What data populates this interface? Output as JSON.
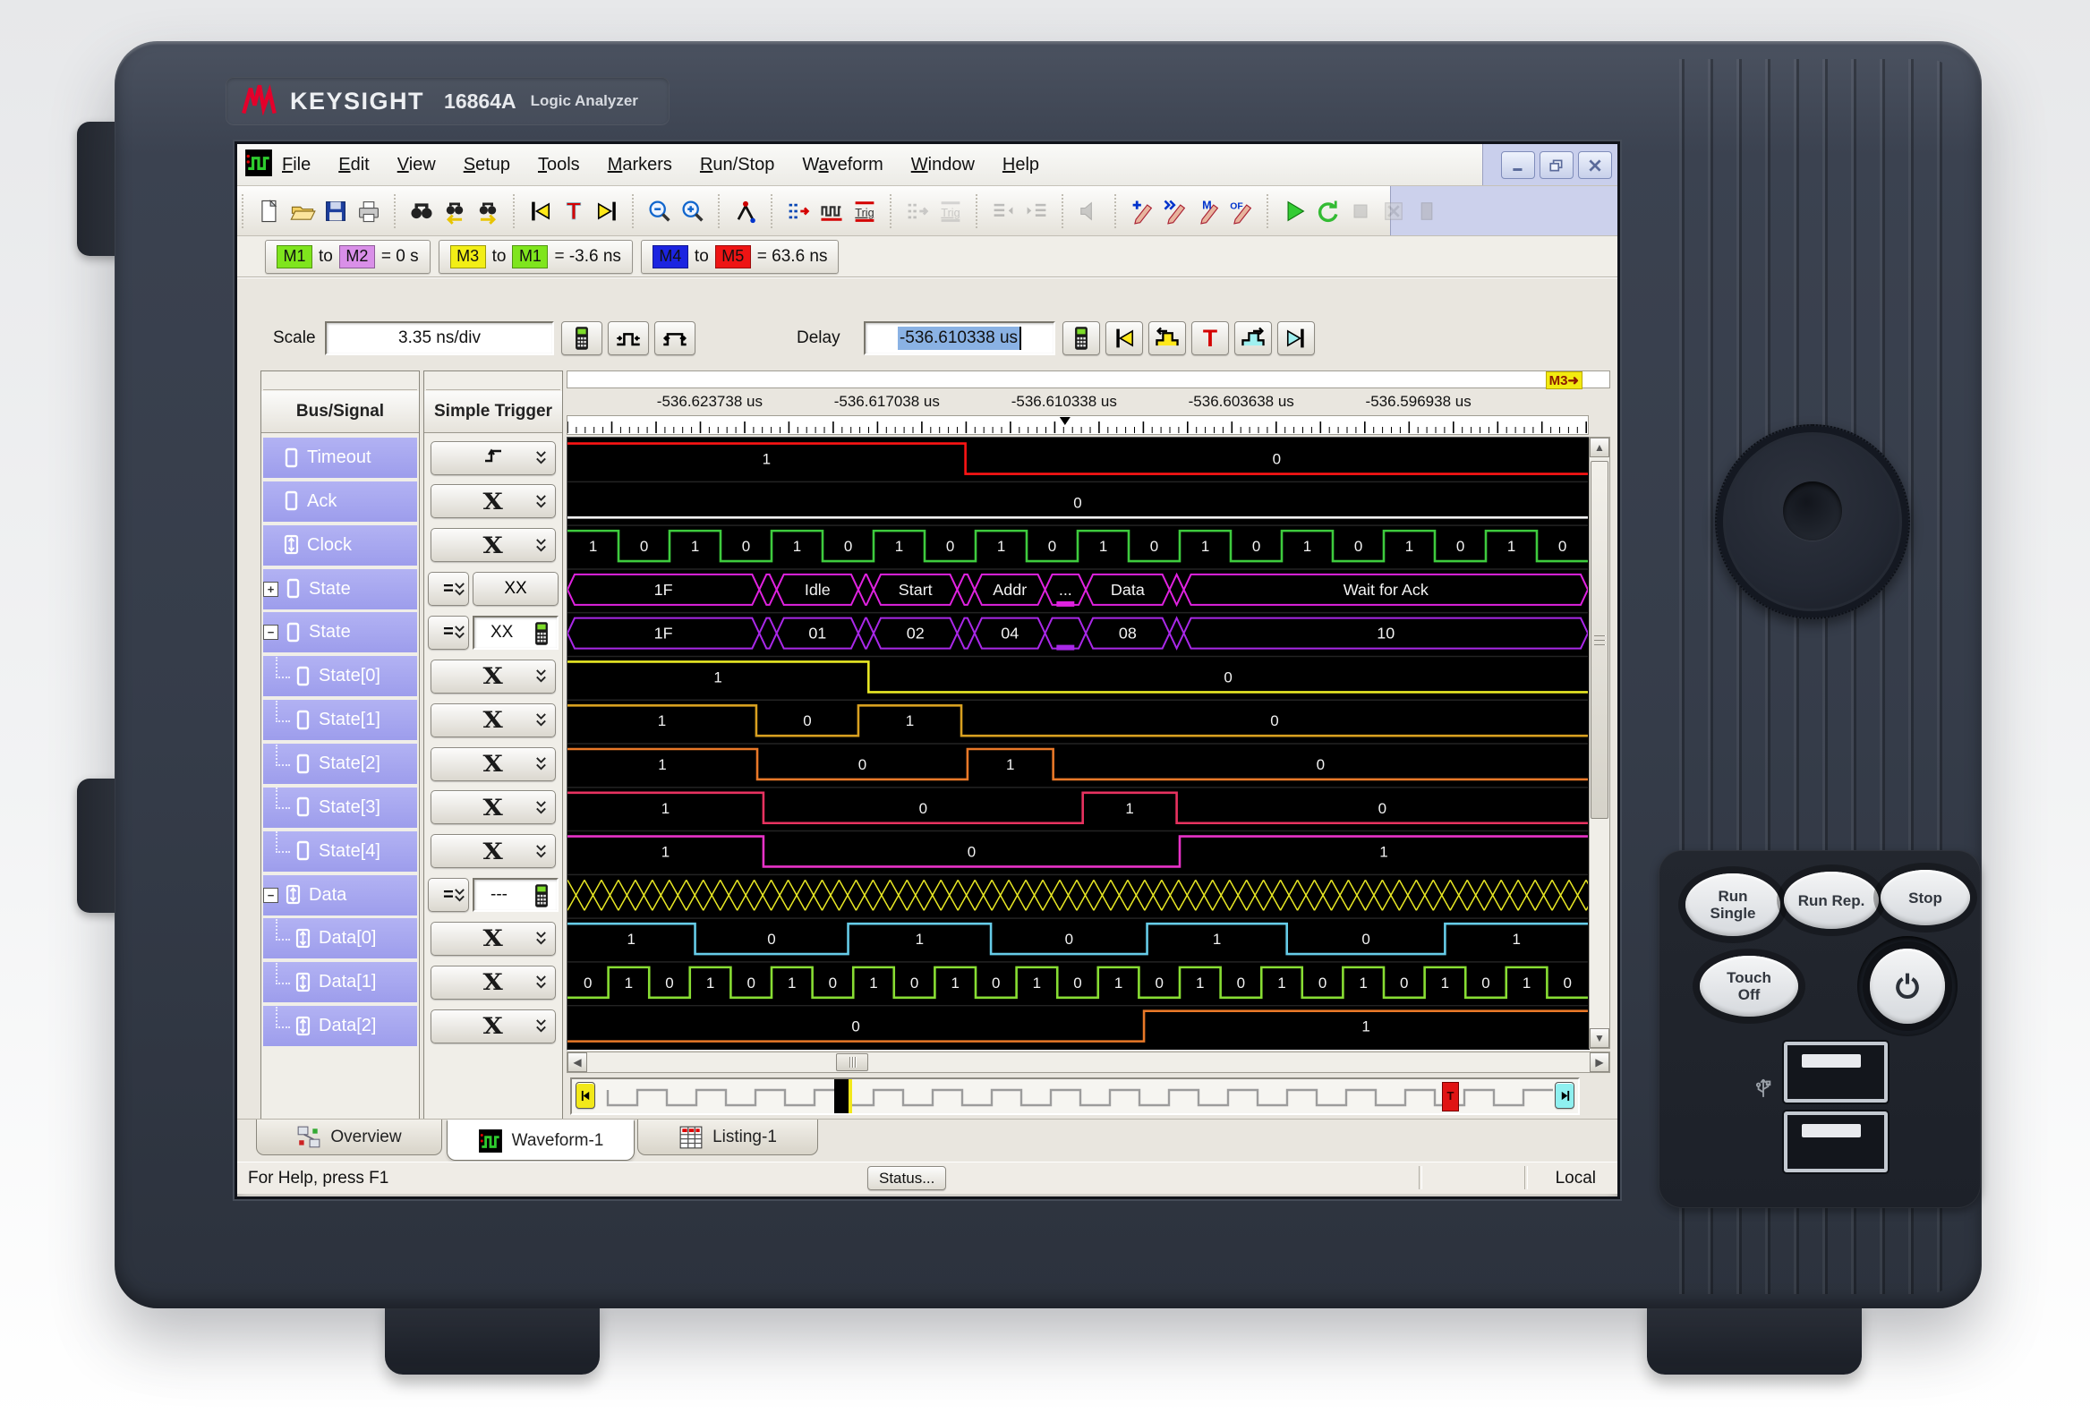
{
  "device": {
    "brand": "KEYSIGHT",
    "model": "16864A",
    "model_desc": "Logic Analyzer",
    "panel_buttons": [
      {
        "name": "run-single",
        "lines": [
          "Run",
          "Single"
        ]
      },
      {
        "name": "run-repetitive",
        "lines": [
          "Run Rep."
        ]
      },
      {
        "name": "stop",
        "lines": [
          "Stop"
        ]
      },
      {
        "name": "touch-off",
        "lines": [
          "Touch",
          "Off"
        ]
      },
      {
        "name": "power",
        "lines": [],
        "icon": "power-icon"
      }
    ],
    "ports": [
      "usb-port-top",
      "usb-port-bottom"
    ]
  },
  "window": {
    "menu": [
      {
        "label": "File",
        "u": 0
      },
      {
        "label": "Edit",
        "u": 0
      },
      {
        "label": "View",
        "u": 0
      },
      {
        "label": "Setup",
        "u": 0
      },
      {
        "label": "Tools",
        "u": 0
      },
      {
        "label": "Markers",
        "u": 0
      },
      {
        "label": "Run/Stop",
        "u": 0
      },
      {
        "label": "Waveform",
        "u": 1
      },
      {
        "label": "Window",
        "u": 0
      },
      {
        "label": "Help",
        "u": 0
      }
    ],
    "app_icon": "waveform-app-icon",
    "window_buttons": [
      "minimize",
      "restore",
      "close"
    ],
    "toolbar_groups": [
      {
        "items": [
          {
            "name": "new-document"
          },
          {
            "name": "open-file"
          },
          {
            "name": "save"
          },
          {
            "name": "print"
          }
        ]
      },
      {
        "items": [
          {
            "name": "find"
          },
          {
            "name": "find-previous"
          },
          {
            "name": "find-next"
          }
        ]
      },
      {
        "items": [
          {
            "name": "go-to-start"
          },
          {
            "name": "go-to-trigger"
          },
          {
            "name": "go-to-end"
          }
        ]
      },
      {
        "items": [
          {
            "name": "zoom-out"
          },
          {
            "name": "zoom-in"
          }
        ]
      },
      {
        "items": [
          {
            "name": "marker-tool"
          }
        ]
      },
      {
        "items": [
          {
            "name": "bus-signal-setup"
          },
          {
            "name": "sampling-setup"
          },
          {
            "name": "trigger-setup"
          }
        ]
      },
      {
        "items": [
          {
            "name": "bus-signal-setup-alt",
            "disabled": true
          },
          {
            "name": "trigger-setup-alt",
            "disabled": true
          }
        ]
      },
      {
        "items": [
          {
            "name": "listing-move-left",
            "disabled": true
          },
          {
            "name": "listing-move-right",
            "disabled": true
          }
        ]
      },
      {
        "items": [
          {
            "name": "sound",
            "disabled": true
          }
        ]
      },
      {
        "items": [
          {
            "name": "marker-new"
          },
          {
            "name": "marker-next"
          },
          {
            "name": "marker-goto"
          },
          {
            "name": "marker-options"
          }
        ]
      },
      {
        "items": [
          {
            "name": "run"
          },
          {
            "name": "run-repetitive"
          },
          {
            "name": "stop-run",
            "disabled": true
          },
          {
            "name": "cancel",
            "disabled": true
          },
          {
            "name": "halt",
            "disabled": true
          }
        ]
      }
    ],
    "markers_bar": [
      {
        "a": "M1",
        "a_color": "#7fe51d",
        "b": "M2",
        "b_color": "#d98fe8",
        "value": "= 0 s"
      },
      {
        "a": "M3",
        "a_color": "#f2ee16",
        "b": "M1",
        "b_color": "#7fe51d",
        "value": "= -3.6 ns"
      },
      {
        "a": "M4",
        "a_color": "#1c24e0",
        "b": "M5",
        "b_color": "#ee1414",
        "value": "= 63.6 ns"
      }
    ],
    "controls": {
      "scale_label": "Scale",
      "scale_value": "3.35 ns/div",
      "scale_buttons": [
        "calculator",
        "pulse-zoom-in",
        "pulse-zoom-out"
      ],
      "delay_label": "Delay",
      "delay_value": "-536.610338 us",
      "delay_buttons": [
        "calculator",
        "delay-go-start",
        "delay-prev-edge",
        "delay-trigger",
        "delay-next-edge",
        "delay-go-end"
      ]
    },
    "columns": {
      "bus_signal_header": "Bus/Signal",
      "simple_trigger_header": "Simple Trigger"
    },
    "signals": [
      {
        "name": "Timeout",
        "icon": "signal",
        "child": false,
        "trigger": {
          "kind": "edge"
        }
      },
      {
        "name": "Ack",
        "icon": "signal",
        "child": false,
        "trigger": {
          "kind": "any",
          "glyph": "X"
        }
      },
      {
        "name": "Clock",
        "icon": "clock",
        "child": false,
        "trigger": {
          "kind": "any",
          "glyph": "X"
        }
      },
      {
        "name": "State",
        "icon": "signal",
        "child": false,
        "expand": "+",
        "trigger": {
          "kind": "compare-button",
          "op": "=",
          "value": "XX"
        }
      },
      {
        "name": "State",
        "icon": "signal",
        "child": false,
        "expand": "−",
        "trigger": {
          "kind": "compare-input",
          "op": "=",
          "value": "XX"
        }
      },
      {
        "name": "State[0]",
        "icon": "signal",
        "child": true,
        "trigger": {
          "kind": "any",
          "glyph": "X"
        }
      },
      {
        "name": "State[1]",
        "icon": "signal",
        "child": true,
        "trigger": {
          "kind": "any",
          "glyph": "X"
        }
      },
      {
        "name": "State[2]",
        "icon": "signal",
        "child": true,
        "trigger": {
          "kind": "any",
          "glyph": "X"
        }
      },
      {
        "name": "State[3]",
        "icon": "signal",
        "child": true,
        "trigger": {
          "kind": "any",
          "glyph": "X"
        }
      },
      {
        "name": "State[4]",
        "icon": "signal",
        "child": true,
        "trigger": {
          "kind": "any",
          "glyph": "X"
        }
      },
      {
        "name": "Data",
        "icon": "clock",
        "child": false,
        "expand": "−",
        "trigger": {
          "kind": "compare-input",
          "op": "=",
          "value": "---"
        }
      },
      {
        "name": "Data[0]",
        "icon": "clock",
        "child": true,
        "trigger": {
          "kind": "any",
          "glyph": "X"
        }
      },
      {
        "name": "Data[1]",
        "icon": "clock",
        "child": true,
        "trigger": {
          "kind": "any",
          "glyph": "X"
        }
      },
      {
        "name": "Data[2]",
        "icon": "clock",
        "child": true,
        "trigger": {
          "kind": "any",
          "glyph": "X"
        }
      }
    ],
    "timebase": {
      "axis_labels": [
        "-536.623738 us",
        "-536.617038 us",
        "-536.610338 us",
        "-536.603638 us",
        "-536.596938 us"
      ],
      "axis_label_fracs": [
        0.14,
        0.3133,
        0.4867,
        0.66,
        0.8333
      ],
      "trigger_frac": 0.4867,
      "marker_badge": "M3"
    },
    "waveforms": [
      {
        "name": "Timeout",
        "type": "digital",
        "color": "#ff1414",
        "segs": [
          [
            0,
            0.39,
            1
          ],
          [
            0.39,
            1,
            0
          ]
        ]
      },
      {
        "name": "Ack",
        "type": "digital",
        "color": "#f2f2f2",
        "segs": [
          [
            0,
            1,
            0
          ]
        ]
      },
      {
        "name": "Clock",
        "type": "digital",
        "color": "#3ecb3e",
        "segs": [
          [
            0,
            0.05,
            1
          ],
          [
            0.05,
            0.1,
            0
          ],
          [
            0.1,
            0.15,
            1
          ],
          [
            0.15,
            0.2,
            0
          ],
          [
            0.2,
            0.25,
            1
          ],
          [
            0.25,
            0.3,
            0
          ],
          [
            0.3,
            0.35,
            1
          ],
          [
            0.35,
            0.4,
            0
          ],
          [
            0.4,
            0.45,
            1
          ],
          [
            0.45,
            0.5,
            0
          ],
          [
            0.5,
            0.55,
            1
          ],
          [
            0.55,
            0.6,
            0
          ],
          [
            0.6,
            0.65,
            1
          ],
          [
            0.65,
            0.7,
            0
          ],
          [
            0.7,
            0.75,
            1
          ],
          [
            0.75,
            0.8,
            0
          ],
          [
            0.8,
            0.85,
            1
          ],
          [
            0.85,
            0.9,
            0
          ],
          [
            0.9,
            0.95,
            1
          ],
          [
            0.95,
            1,
            0
          ]
        ]
      },
      {
        "name": "State",
        "type": "bus",
        "color": "#e022e0",
        "segs": [
          {
            "a": 0,
            "b": 0.188,
            "t": "1F"
          },
          {
            "a": 0.188,
            "b": 0.205,
            "t": ""
          },
          {
            "a": 0.205,
            "b": 0.285,
            "t": "Idle"
          },
          {
            "a": 0.285,
            "b": 0.3,
            "t": ""
          },
          {
            "a": 0.3,
            "b": 0.382,
            "t": "Start"
          },
          {
            "a": 0.382,
            "b": 0.399,
            "t": ""
          },
          {
            "a": 0.399,
            "b": 0.468,
            "t": "Addr"
          },
          {
            "a": 0.468,
            "b": 0.508,
            "t": "...",
            "c": 1
          },
          {
            "a": 0.508,
            "b": 0.59,
            "t": "Data"
          },
          {
            "a": 0.59,
            "b": 0.604,
            "t": ""
          },
          {
            "a": 0.604,
            "b": 1,
            "t": "Wait for Ack"
          }
        ]
      },
      {
        "name": "State",
        "type": "bus",
        "color": "#a928e8",
        "segs": [
          {
            "a": 0,
            "b": 0.188,
            "t": "1F"
          },
          {
            "a": 0.188,
            "b": 0.205,
            "t": ""
          },
          {
            "a": 0.205,
            "b": 0.285,
            "t": "01"
          },
          {
            "a": 0.285,
            "b": 0.3,
            "t": ""
          },
          {
            "a": 0.3,
            "b": 0.382,
            "t": "02"
          },
          {
            "a": 0.382,
            "b": 0.399,
            "t": ""
          },
          {
            "a": 0.399,
            "b": 0.468,
            "t": "04"
          },
          {
            "a": 0.468,
            "b": 0.508,
            "t": "",
            "c": 1
          },
          {
            "a": 0.508,
            "b": 0.59,
            "t": "08"
          },
          {
            "a": 0.59,
            "b": 0.604,
            "t": ""
          },
          {
            "a": 0.604,
            "b": 1,
            "t": "10"
          }
        ]
      },
      {
        "name": "State[0]",
        "type": "digital",
        "color": "#e8e824",
        "segs": [
          [
            0,
            0.295,
            1
          ],
          [
            0.295,
            1,
            0
          ]
        ]
      },
      {
        "name": "State[1]",
        "type": "digital",
        "color": "#d8a020",
        "segs": [
          [
            0,
            0.185,
            1
          ],
          [
            0.185,
            0.285,
            0
          ],
          [
            0.285,
            0.386,
            1
          ],
          [
            0.386,
            1,
            0
          ]
        ]
      },
      {
        "name": "State[2]",
        "type": "digital",
        "color": "#e87828",
        "segs": [
          [
            0,
            0.186,
            1
          ],
          [
            0.186,
            0.392,
            0
          ],
          [
            0.392,
            0.476,
            1
          ],
          [
            0.476,
            1,
            0
          ]
        ]
      },
      {
        "name": "State[3]",
        "type": "digital",
        "color": "#e83260",
        "segs": [
          [
            0,
            0.192,
            1
          ],
          [
            0.192,
            0.505,
            0
          ],
          [
            0.505,
            0.597,
            1
          ],
          [
            0.597,
            1,
            0
          ]
        ]
      },
      {
        "name": "State[4]",
        "type": "digital",
        "color": "#e832c8",
        "segs": [
          [
            0,
            0.192,
            1
          ],
          [
            0.192,
            0.6,
            0
          ],
          [
            0.6,
            1,
            1
          ]
        ]
      },
      {
        "name": "Data",
        "type": "busy",
        "color": "#e8e824"
      },
      {
        "name": "Data[0]",
        "type": "digital",
        "color": "#66cce8",
        "segs": [
          [
            0,
            0.125,
            1
          ],
          [
            0.125,
            0.275,
            0
          ],
          [
            0.275,
            0.415,
            1
          ],
          [
            0.415,
            0.568,
            0
          ],
          [
            0.568,
            0.705,
            1
          ],
          [
            0.705,
            0.86,
            0
          ],
          [
            0.86,
            1,
            1
          ]
        ]
      },
      {
        "name": "Data[1]",
        "type": "digital",
        "color": "#88dd33",
        "segs": [
          [
            0,
            0.04,
            0
          ],
          [
            0.04,
            0.08,
            1
          ],
          [
            0.08,
            0.12,
            0
          ],
          [
            0.12,
            0.16,
            1
          ],
          [
            0.16,
            0.2,
            0
          ],
          [
            0.2,
            0.24,
            1
          ],
          [
            0.24,
            0.28,
            0
          ],
          [
            0.28,
            0.32,
            1
          ],
          [
            0.32,
            0.36,
            0
          ],
          [
            0.36,
            0.4,
            1
          ],
          [
            0.4,
            0.44,
            0
          ],
          [
            0.44,
            0.48,
            1
          ],
          [
            0.48,
            0.52,
            0
          ],
          [
            0.52,
            0.56,
            1
          ],
          [
            0.56,
            0.6,
            0
          ],
          [
            0.6,
            0.64,
            1
          ],
          [
            0.64,
            0.68,
            0
          ],
          [
            0.68,
            0.72,
            1
          ],
          [
            0.72,
            0.76,
            0
          ],
          [
            0.76,
            0.8,
            1
          ],
          [
            0.8,
            0.84,
            0
          ],
          [
            0.84,
            0.88,
            1
          ],
          [
            0.88,
            0.92,
            0
          ],
          [
            0.92,
            0.96,
            1
          ],
          [
            0.96,
            1,
            0
          ]
        ]
      },
      {
        "name": "Data[2]",
        "type": "digital",
        "color": "#e87828",
        "segs": [
          [
            0,
            0.565,
            0
          ],
          [
            0.565,
            1,
            1
          ]
        ]
      }
    ],
    "navbar": {
      "position_frac": 0.268,
      "trigger_frac": 0.872
    },
    "tabs": [
      {
        "label": "Overview",
        "icon": "overview-icon",
        "active": false
      },
      {
        "label": "Waveform-1",
        "icon": "waveform-tab-icon",
        "active": true
      },
      {
        "label": "Listing-1",
        "icon": "listing-icon",
        "active": false
      }
    ],
    "status": {
      "help": "For Help, press F1",
      "status_button": "Status...",
      "mode": "Local"
    }
  }
}
